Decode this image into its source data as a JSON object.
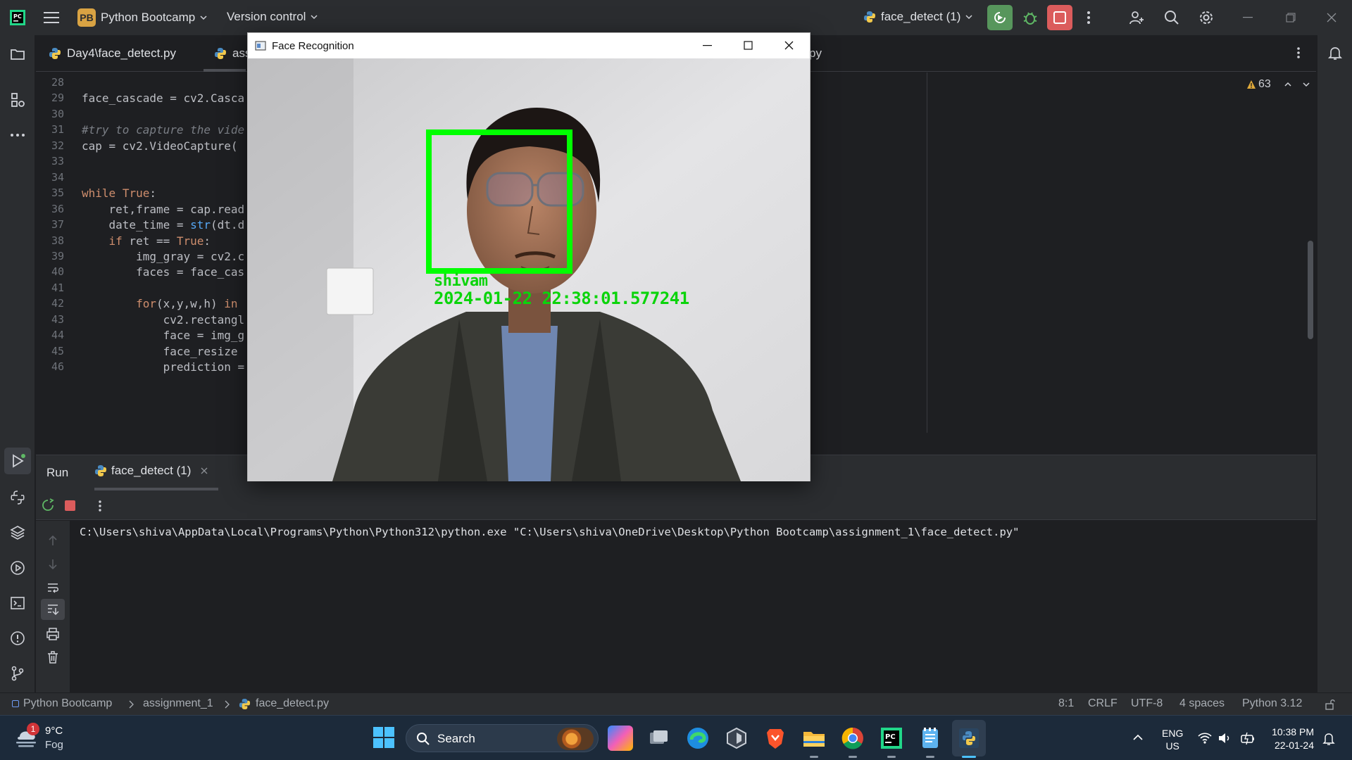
{
  "titlebar": {
    "project_initials": "PB",
    "project_name": "Python Bootcamp",
    "vcs_label": "Version control",
    "run_config": "face_detect (1)"
  },
  "editor": {
    "tabs": [
      {
        "label": "Day4\\face_detect.py"
      },
      {
        "label": "ass"
      },
      {
        "label": "py"
      }
    ],
    "inspection_count": "63",
    "lines": [
      {
        "num": "28",
        "code": ""
      },
      {
        "num": "29",
        "code": "face_cascade = cv2.Casca"
      },
      {
        "num": "30",
        "code": ""
      },
      {
        "num": "31",
        "code": "#try to capture the vide"
      },
      {
        "num": "32",
        "code": "cap = cv2.VideoCapture("
      },
      {
        "num": "33",
        "code": ""
      },
      {
        "num": "34",
        "code": ""
      },
      {
        "num": "35",
        "code": "while True:"
      },
      {
        "num": "36",
        "code": "    ret,frame = cap.read"
      },
      {
        "num": "37",
        "code": "    date_time = str(dt.d"
      },
      {
        "num": "38",
        "code": "    if ret == True:"
      },
      {
        "num": "39",
        "code": "        img_gray = cv2.c"
      },
      {
        "num": "40",
        "code": "        faces = face_cas"
      },
      {
        "num": "41",
        "code": ""
      },
      {
        "num": "42",
        "code": "        for(x,y,w,h) in "
      },
      {
        "num": "43",
        "code": "            cv2.rectangl"
      },
      {
        "num": "44",
        "code": "            face = img_g"
      },
      {
        "num": "45",
        "code": "            face_resize "
      },
      {
        "num": "46",
        "code": "            prediction ="
      }
    ]
  },
  "run_panel": {
    "run_tab": "Run",
    "config_tab": "face_detect (1)",
    "console_command": "C:\\Users\\shiva\\AppData\\Local\\Programs\\Python\\Python312\\python.exe \"C:\\Users\\shiva\\OneDrive\\Desktop\\Python Bootcamp\\assignment_1\\face_detect.py\""
  },
  "statusbar": {
    "breadcrumb": [
      "Python Bootcamp",
      "assignment_1",
      "face_detect.py"
    ],
    "cursor_pos": "8:1",
    "line_sep": "CRLF",
    "encoding": "UTF-8",
    "indent": "4 spaces",
    "interpreter": "Python 3.12"
  },
  "face_window": {
    "title": "Face Recognition",
    "detected_name": "shivam",
    "timestamp": "2024-01-22 22:38:01.577241",
    "box_color": "#00ff00"
  },
  "taskbar": {
    "weather_temp": "9°C",
    "weather_desc": "Fog",
    "weather_badge": "1",
    "search_label": "Search",
    "lang_top": "ENG",
    "lang_bottom": "US",
    "time": "10:38 PM",
    "date": "22-01-24"
  },
  "icons": [
    "pycharm-logo-icon",
    "hamburger-menu-icon",
    "chevron-down-icon",
    "python-file-icon",
    "rerun-icon",
    "debug-icon",
    "stop-icon",
    "more-vertical-icon",
    "add-user-icon",
    "search-icon",
    "gear-icon",
    "minimize-icon",
    "restore-icon",
    "close-icon",
    "folder-icon",
    "structure-icon",
    "more-horizontal-icon",
    "bell-icon",
    "warning-icon",
    "chevron-up-icon",
    "run-icon",
    "python-console-icon",
    "layers-icon",
    "services-icon",
    "terminal-icon",
    "problems-icon",
    "git-icon",
    "arrow-up-icon",
    "arrow-down-icon",
    "soft-wrap-icon",
    "scroll-end-icon",
    "print-icon",
    "trash-icon",
    "lock-icon",
    "windows-start-icon",
    "wifi-icon",
    "volume-icon",
    "battery-icon",
    "notification-bell-icon",
    "maximize-icon"
  ],
  "colors": {
    "ide_bg": "#1e1f22",
    "ide_panel": "#2b2d30",
    "rerun_green": "#57965c",
    "stop_red": "#db5c5c",
    "keyword": "#cf8e6d",
    "detection_green": "#0bd40b"
  }
}
